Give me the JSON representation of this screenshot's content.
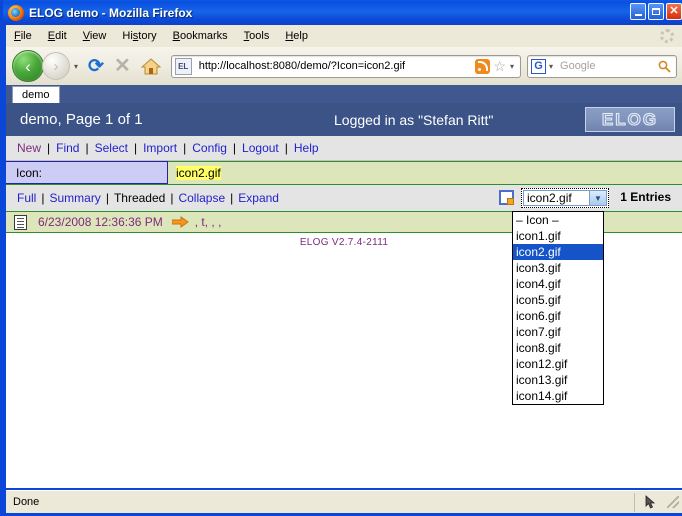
{
  "window": {
    "title": "ELOG demo - Mozilla Firefox",
    "controls": {
      "minimize": "_",
      "maximize": "□",
      "close": "✕"
    }
  },
  "menubar": {
    "items": [
      "File",
      "Edit",
      "View",
      "History",
      "Bookmarks",
      "Tools",
      "Help"
    ]
  },
  "toolbar": {
    "back": "‹",
    "forward": "›",
    "history_caret": "▾",
    "reload": "⟳",
    "stop": "✕",
    "home": "home-icon",
    "url": "http://localhost:8080/demo/?Icon=icon2.gif",
    "favicon_label": "EL",
    "rss": "rss-icon",
    "star": "☆",
    "bookmark_caret": "▾",
    "search_engine": "G",
    "search_engine_caret": "▾",
    "search_placeholder": "Google",
    "magnifier": "search-icon"
  },
  "tab": {
    "label": "demo"
  },
  "elog": {
    "header": {
      "title": "demo, Page 1 of 1",
      "login": "Logged in as \"Stefan Ritt\"",
      "logo": "ELOG"
    },
    "nav": [
      {
        "label": "New",
        "visited": true
      },
      {
        "label": "Find",
        "visited": false
      },
      {
        "label": "Select",
        "visited": false
      },
      {
        "label": "Import",
        "visited": false
      },
      {
        "label": "Config",
        "visited": false
      },
      {
        "label": "Logout",
        "visited": false
      },
      {
        "label": "Help",
        "visited": false
      }
    ],
    "filter": {
      "label": "Icon:",
      "value": "icon2.gif"
    },
    "toolbar": {
      "links": [
        {
          "label": "Full",
          "active": false
        },
        {
          "label": "Summary",
          "active": false
        },
        {
          "label": "Threaded",
          "active": true
        },
        {
          "label": "Collapse",
          "active": false
        },
        {
          "label": "Expand",
          "active": false
        }
      ],
      "new_page_icon": "new-page-icon",
      "select_value": "icon2.gif",
      "select_arrow": "▼",
      "entries_count": "1 Entries"
    },
    "dropdown": {
      "options": [
        "– Icon –",
        "icon1.gif",
        "icon2.gif",
        "icon3.gif",
        "icon4.gif",
        "icon5.gif",
        "icon6.gif",
        "icon7.gif",
        "icon8.gif",
        "icon12.gif",
        "icon13.gif",
        "icon14.gif"
      ],
      "selected": "icon2.gif"
    },
    "entry": {
      "icon": "logbook-entry-icon",
      "date": "6/23/2008 12:36:36 PM",
      "arrow_icon": "orange-arrow-icon",
      "attributes": ", t, , ,"
    },
    "version": "ELOG V2.7.4-2111"
  },
  "statusbar": {
    "text": "Done"
  },
  "colors": {
    "titlebar": "#0b4fe0",
    "elog_header": "#3c5387",
    "link": "#2222cc",
    "visited_link": "#7d2a7d",
    "filter_label_bg": "#ccccf5",
    "filter_value_bg": "#dde6bb",
    "highlight": "#ffff66",
    "entry_bg": "#dde6bb",
    "select_highlight": "#1453c8",
    "accent_orange": "#f08a1c"
  }
}
